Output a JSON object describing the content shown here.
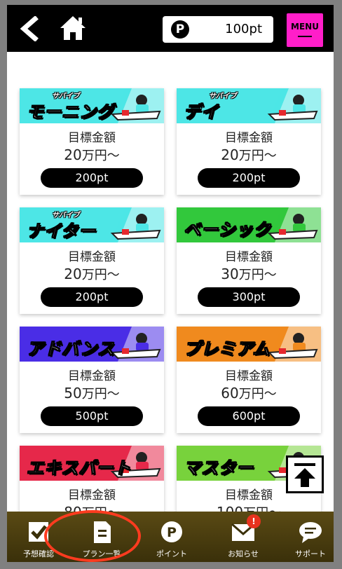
{
  "header": {
    "points_value": "100pt",
    "points_icon_letter": "P",
    "menu_label": "MENU"
  },
  "plans": [
    {
      "banner_title": "モーニング",
      "banner_sub": "サバイブ",
      "banner_color": "#4de6e6",
      "target_label": "目標金額",
      "target_num": "20",
      "target_unit": "万円〜",
      "price": "200pt"
    },
    {
      "banner_title": "デイ",
      "banner_sub": "サバイブ",
      "banner_color": "#4de6e6",
      "target_label": "目標金額",
      "target_num": "20",
      "target_unit": "万円〜",
      "price": "200pt"
    },
    {
      "banner_title": "ナイター",
      "banner_sub": "サバイブ",
      "banner_color": "#4de6e6",
      "target_label": "目標金額",
      "target_num": "20",
      "target_unit": "万円〜",
      "price": "200pt"
    },
    {
      "banner_title": "ベーシック",
      "banner_sub": "",
      "banner_color": "#32c83c",
      "target_label": "目標金額",
      "target_num": "30",
      "target_unit": "万円〜",
      "price": "300pt"
    },
    {
      "banner_title": "アドバンス",
      "banner_sub": "",
      "banner_color": "#4a2de6",
      "target_label": "目標金額",
      "target_num": "50",
      "target_unit": "万円〜",
      "price": "500pt"
    },
    {
      "banner_title": "プレミアム",
      "banner_sub": "",
      "banner_color": "#f08a1e",
      "target_label": "目標金額",
      "target_num": "60",
      "target_unit": "万円〜",
      "price": "600pt"
    },
    {
      "banner_title": "エキスパート",
      "banner_sub": "",
      "banner_color": "#e6284a",
      "target_label": "目標金額",
      "target_num": "80",
      "target_unit": "万円〜",
      "price": ""
    },
    {
      "banner_title": "マスター",
      "banner_sub": "",
      "banner_color": "#78d23c",
      "target_label": "目標金額",
      "target_num": "100",
      "target_unit": "万円〜",
      "price": ""
    }
  ],
  "footer": {
    "items": [
      {
        "label": "予想確認",
        "icon": "check-icon"
      },
      {
        "label": "プラン一覧",
        "icon": "document-icon"
      },
      {
        "label": "ポイント",
        "icon": "points-icon"
      },
      {
        "label": "お知らせ",
        "icon": "mail-icon",
        "badge": "!"
      },
      {
        "label": "サポート",
        "icon": "chat-bubble-icon"
      }
    ]
  }
}
